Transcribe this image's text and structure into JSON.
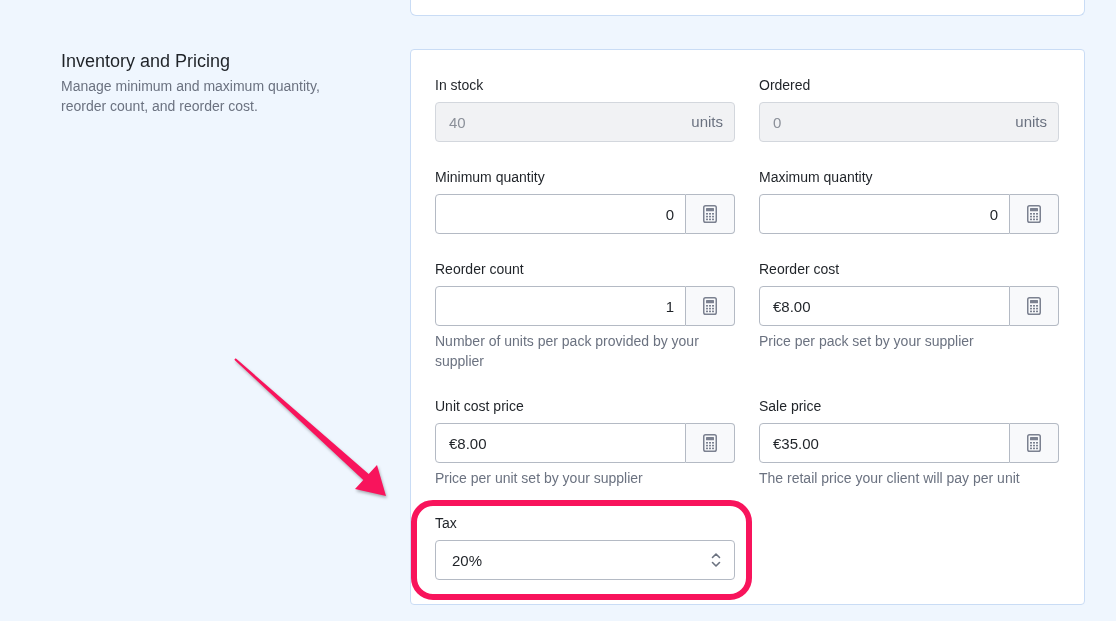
{
  "section": {
    "title": "Inventory and Pricing",
    "description": "Manage minimum and maximum quantity, reorder count, and reorder cost."
  },
  "fields": [
    {
      "kind": "units",
      "label": "In stock",
      "value": "40",
      "suffix": "units",
      "disabled": true,
      "highlighted": false
    },
    {
      "kind": "units",
      "label": "Ordered",
      "value": "0",
      "suffix": "units",
      "disabled": true,
      "highlighted": false
    },
    {
      "kind": "quantity",
      "label": "Minimum quantity",
      "value": "0",
      "disabled": false,
      "highlighted": false
    },
    {
      "kind": "quantity",
      "label": "Maximum quantity",
      "value": "0",
      "disabled": false,
      "highlighted": false
    },
    {
      "kind": "quantity",
      "label": "Reorder count",
      "value": "1",
      "help": "Number of units per pack provided by your supplier",
      "disabled": false,
      "highlighted": false
    },
    {
      "kind": "money",
      "label": "Reorder cost",
      "value": "€8.00",
      "help": "Price per pack set by your supplier",
      "disabled": false,
      "highlighted": false
    },
    {
      "kind": "money",
      "label": "Unit cost price",
      "value": "€8.00",
      "help": "Price per unit set by your supplier",
      "disabled": false,
      "highlighted": false
    },
    {
      "kind": "money",
      "label": "Sale price",
      "value": "€35.00",
      "help": "The retail price your client will pay per unit",
      "disabled": false,
      "highlighted": false
    },
    {
      "kind": "select",
      "label": "Tax",
      "value": "20%",
      "disabled": false,
      "highlighted": true
    }
  ]
}
